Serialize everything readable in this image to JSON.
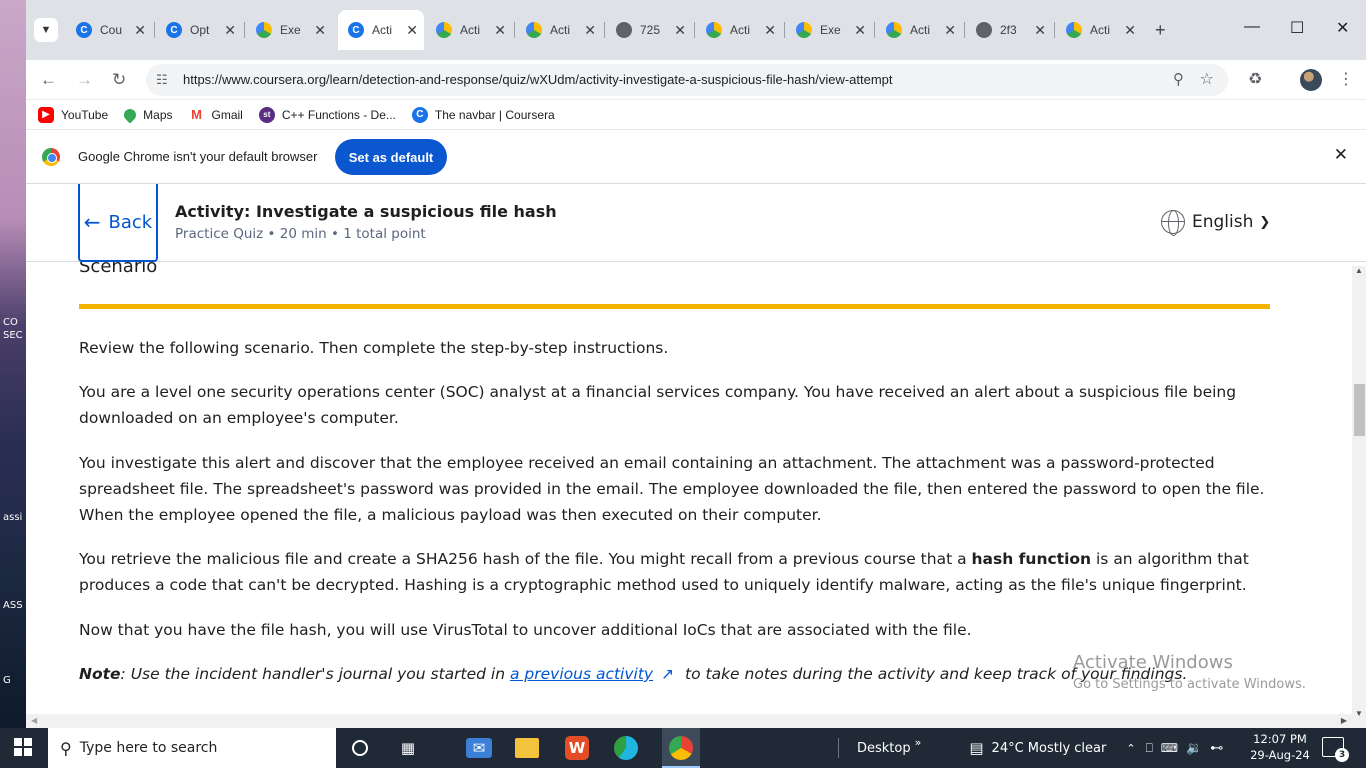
{
  "desktop": {
    "fragments": [
      "CO",
      "SEC",
      "assi",
      "ASS",
      "G"
    ]
  },
  "tabs": [
    {
      "title": "Cou",
      "icon": "coursera-icon"
    },
    {
      "title": "Opt",
      "icon": "coursera-icon"
    },
    {
      "title": "Exe",
      "icon": "drive-icon"
    },
    {
      "title": "Acti",
      "icon": "coursera-icon",
      "active": true
    },
    {
      "title": "Acti",
      "icon": "drive-icon"
    },
    {
      "title": "Acti",
      "icon": "drive-icon"
    },
    {
      "title": "725",
      "icon": "globe-icon"
    },
    {
      "title": "Acti",
      "icon": "drive-icon"
    },
    {
      "title": "Exe",
      "icon": "drive-icon"
    },
    {
      "title": "Acti",
      "icon": "drive-icon"
    },
    {
      "title": "2f3",
      "icon": "globe-icon"
    },
    {
      "title": "Acti",
      "icon": "drive-icon"
    }
  ],
  "address_bar": {
    "url": "https://www.coursera.org/learn/detection-and-response/quiz/wXUdm/activity-investigate-a-suspicious-file-hash/view-attempt"
  },
  "bookmarks": [
    {
      "label": "YouTube",
      "icon": "youtube-icon",
      "color": "#ff0000"
    },
    {
      "label": "Maps",
      "icon": "maps-pin-icon",
      "color": "#34a853"
    },
    {
      "label": "Gmail",
      "icon": "gmail-icon",
      "color": "#ea4335"
    },
    {
      "label": "C++ Functions - De...",
      "icon": "st-icon",
      "color": "#5a2d82"
    },
    {
      "label": "The navbar | Coursera",
      "icon": "coursera-icon",
      "color": "#1a73e8"
    }
  ],
  "infobar": {
    "message": "Google Chrome isn't your default browser",
    "button": "Set as default"
  },
  "header": {
    "back_label": "Back",
    "title": "Activity: Investigate a suspicious file hash",
    "meta": "Practice Quiz • 20 min • 1 total point",
    "language": "English"
  },
  "content": {
    "heading": "Scenario",
    "p1": "Review the following scenario. Then complete the step-by-step instructions.",
    "p2": "You are a level one security operations center (SOC) analyst at a financial services company. You have received an alert about a suspicious file being downloaded on an employee's computer.",
    "p3": "You investigate this alert and discover that the employee received an email containing an attachment. The attachment was a password-protected spreadsheet file. The spreadsheet's password was provided in the email. The employee downloaded the file, then entered the password to open the file. When the employee opened the file, a malicious payload was then executed on their computer.",
    "p4_before": "You retrieve the malicious file and create a SHA256 hash of the file. You might recall from a previous course that a ",
    "p4_bold": "hash function",
    "p4_after": " is an algorithm that produces a code that can't be decrypted. Hashing is a cryptographic method used to uniquely identify malware, acting as the file's unique fingerprint.",
    "p5": "Now that you have the file hash, you will use VirusTotal to uncover additional IoCs that are associated with the file.",
    "note_label": "Note",
    "note_before": ": Use the incident handler's journal you started in ",
    "note_link": "a previous activity",
    "note_after": " to take notes during the activity and keep track of your findings."
  },
  "watermark": {
    "line1": "Activate Windows",
    "line2": "Go to Settings to activate Windows."
  },
  "taskbar": {
    "search_placeholder": "Type here to search",
    "desktop_label": "Desktop",
    "weather": "24°C  Mostly clear",
    "time": "12:07 PM",
    "date": "29-Aug-24",
    "notification_count": "3"
  }
}
